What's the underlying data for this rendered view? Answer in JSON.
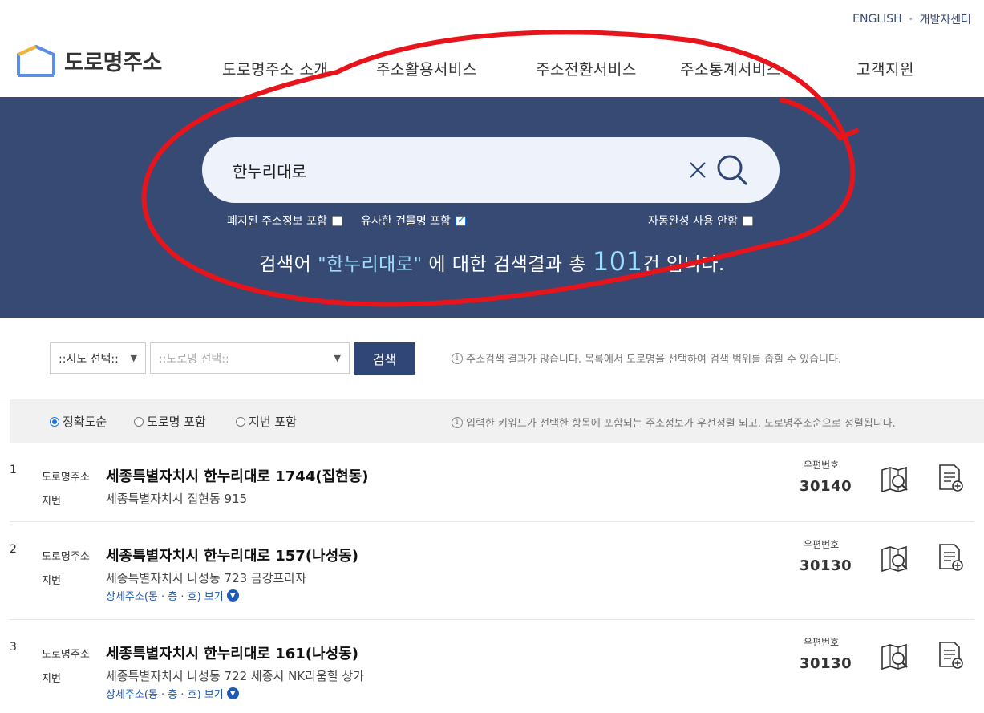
{
  "header": {
    "util_links": [
      "ENGLISH",
      "개발자센터"
    ],
    "logo_text": "도로명주소",
    "nav": [
      "도로명주소 소개",
      "주소활용서비스",
      "주소전환서비스",
      "주소통계서비스",
      "고객지원"
    ]
  },
  "search": {
    "query": "한누리대로",
    "options": [
      {
        "label": "폐지된 주소정보 포함",
        "checked": false
      },
      {
        "label": "유사한 건물명 포함",
        "checked": true
      },
      {
        "label": "자동완성 사용 안함",
        "checked": false
      }
    ],
    "result_prefix": "검색어 ",
    "result_keyword": "\"한누리대로\"",
    "result_middle": " 에 대한 검색결과 총 ",
    "result_count": "101",
    "result_suffix": "건 입니다."
  },
  "filter": {
    "sido_placeholder": "::시도 선택::",
    "road_placeholder": "::도로명 선택::",
    "search_button": "검색",
    "note": "주소검색 결과가 많습니다. 목록에서 도로명을 선택하여 검색 범위를 좁힐 수 있습니다."
  },
  "sort": {
    "options": [
      {
        "label": "정확도순",
        "selected": true
      },
      {
        "label": "도로명 포함",
        "selected": false
      },
      {
        "label": "지번 포함",
        "selected": false
      }
    ],
    "note": "입력한 키워드가 선택한 항목에 포함되는 주소정보가 우선정렬 되고, 도로명주소순으로 정렬됩니다."
  },
  "labels": {
    "road": "도로명주소",
    "jibun": "지번",
    "zip": "우편번호",
    "detail": "상세주소(동 · 층 · 호) 보기"
  },
  "results": [
    {
      "no": "1",
      "road": "세종특별자치시 한누리대로 1744(집현동)",
      "jibun": "세종특별자치시 집현동 915",
      "zip": "30140",
      "has_detail": false
    },
    {
      "no": "2",
      "road": "세종특별자치시 한누리대로 157(나성동)",
      "jibun": "세종특별자치시 나성동 723 금강프라자",
      "zip": "30130",
      "has_detail": true
    },
    {
      "no": "3",
      "road": "세종특별자치시 한누리대로 161(나성동)",
      "jibun": "세종특별자치시 나성동 722 세종시 NK리움힐 상가",
      "zip": "30130",
      "has_detail": true
    }
  ],
  "colors": {
    "banner": "#364a73",
    "accent": "#2f4677",
    "annotation": "#e8141c",
    "highlight": "#9fdcff"
  }
}
